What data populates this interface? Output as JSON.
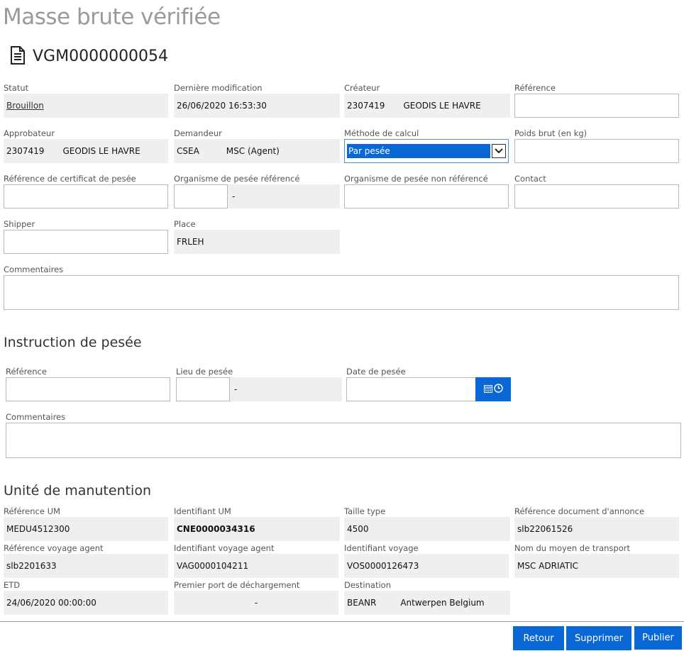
{
  "page": {
    "title": "Masse brute vérifiée",
    "document_id": "VGM0000000054"
  },
  "header_fields": {
    "statut": {
      "label": "Statut",
      "value": "Brouillon"
    },
    "derniere_modification": {
      "label": "Dernière modification",
      "value": "26/06/2020 16:53:30"
    },
    "createur": {
      "label": "Créateur",
      "code": "2307419",
      "name": "GEODIS LE HAVRE"
    },
    "reference": {
      "label": "Référence",
      "value": ""
    },
    "approbateur": {
      "label": "Approbateur",
      "code": "2307419",
      "name": "GEODIS LE HAVRE"
    },
    "demandeur": {
      "label": "Demandeur",
      "code": "CSEA",
      "name": "MSC (Agent)"
    },
    "methode_calcul": {
      "label": "Méthode de calcul",
      "selected": "Par pesée"
    },
    "poids_brut": {
      "label": "Poids brut (en kg)",
      "value": ""
    },
    "ref_certificat": {
      "label": "Référence de certificat de pesée",
      "value": ""
    },
    "organisme_reference": {
      "label": "Organisme de pesée référencé",
      "code": "",
      "name": "-"
    },
    "organisme_non_reference": {
      "label": "Organisme de pesée non référencé",
      "value": ""
    },
    "contact": {
      "label": "Contact",
      "value": ""
    },
    "shipper": {
      "label": "Shipper",
      "value": ""
    },
    "place": {
      "label": "Place",
      "value": "FRLEH"
    },
    "commentaires": {
      "label": "Commentaires",
      "value": ""
    }
  },
  "instruction": {
    "title": "Instruction de pesée",
    "reference": {
      "label": "Référence",
      "value": ""
    },
    "lieu": {
      "label": "Lieu de pesée",
      "code": "",
      "name": "-"
    },
    "date": {
      "label": "Date de pesée",
      "value": ""
    },
    "commentaires": {
      "label": "Commentaires",
      "value": ""
    }
  },
  "unite": {
    "title": "Unité de manutention",
    "ref_um": {
      "label": "Référence UM",
      "value": "MEDU4512300"
    },
    "id_um": {
      "label": "Identifiant UM",
      "value": "CNE0000034316"
    },
    "taille_type": {
      "label": "Taille type",
      "value": "4500"
    },
    "ref_doc_annonce": {
      "label": "Référence document d'annonce",
      "value": "slb22061526"
    },
    "ref_voyage_agent": {
      "label": "Référence voyage agent",
      "value": "slb2201633"
    },
    "id_voyage_agent": {
      "label": "Identifiant voyage agent",
      "value": "VAG0000104211"
    },
    "id_voyage": {
      "label": "Identifiant voyage",
      "value": "VOS0000126473"
    },
    "nom_moyen_transport": {
      "label": "Nom du moyen de transport",
      "value": "MSC ADRIATIC"
    },
    "etd": {
      "label": "ETD",
      "value": "24/06/2020 00:00:00"
    },
    "premier_port": {
      "label": "Premier port de déchargement",
      "value": "-"
    },
    "destination": {
      "label": "Destination",
      "code": "BEANR",
      "name": "Antwerpen Belgium"
    }
  },
  "actions": {
    "retour": "Retour",
    "supprimer": "Supprimer",
    "publier": "Publier"
  },
  "icons": {
    "document": "document-icon",
    "calendar": "calendar-icon",
    "clock": "clock-icon",
    "dropdown": "chevron-down-icon"
  },
  "colors": {
    "accent": "#0a68d6",
    "readonly_bg": "#efefef",
    "title_gray": "#9a9a9a"
  }
}
